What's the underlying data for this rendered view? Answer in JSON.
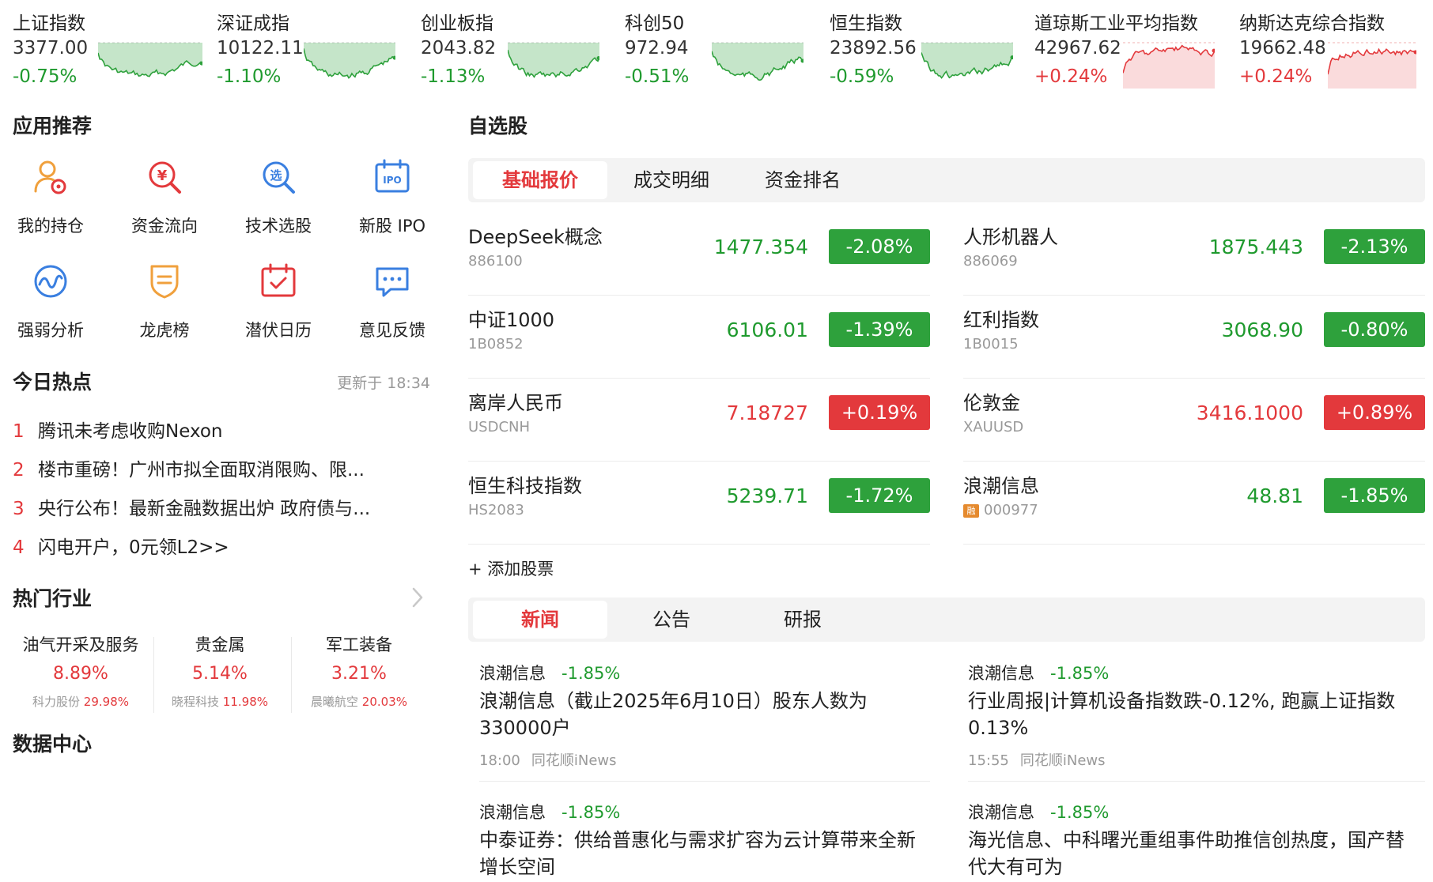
{
  "indices": [
    {
      "name": "上证指数",
      "value": "3377.00",
      "change": "-0.75%",
      "dir": "down"
    },
    {
      "name": "深证成指",
      "value": "10122.11",
      "change": "-1.10%",
      "dir": "down"
    },
    {
      "name": "创业板指",
      "value": "2043.82",
      "change": "-1.13%",
      "dir": "down"
    },
    {
      "name": "科创50",
      "value": "972.94",
      "change": "-0.51%",
      "dir": "down"
    },
    {
      "name": "恒生指数",
      "value": "23892.56",
      "change": "-0.59%",
      "dir": "down"
    },
    {
      "name": "道琼斯工业平均指数",
      "value": "42967.62",
      "change": "+0.24%",
      "dir": "up"
    },
    {
      "name": "纳斯达克综合指数",
      "value": "19662.48",
      "change": "+0.24%",
      "dir": "up"
    }
  ],
  "apps": {
    "title": "应用推荐",
    "items": [
      {
        "label": "我的持仓",
        "icon": "portfolio-icon"
      },
      {
        "label": "资金流向",
        "icon": "fund-flow-icon"
      },
      {
        "label": "技术选股",
        "icon": "stock-picker-icon"
      },
      {
        "label": "新股 IPO",
        "icon": "ipo-icon"
      },
      {
        "label": "强弱分析",
        "icon": "strength-analysis-icon"
      },
      {
        "label": "龙虎榜",
        "icon": "dragon-tiger-icon"
      },
      {
        "label": "潜伏日历",
        "icon": "calendar-icon"
      },
      {
        "label": "意见反馈",
        "icon": "feedback-icon"
      }
    ]
  },
  "hot": {
    "title": "今日热点",
    "updated": "更新于 18:34",
    "items": [
      {
        "no": "1",
        "text": "腾讯未考虑收购Nexon"
      },
      {
        "no": "2",
        "text": "楼市重磅！广州市拟全面取消限购、限..."
      },
      {
        "no": "3",
        "text": "央行公布！最新金融数据出炉 政府债与..."
      },
      {
        "no": "4",
        "text": "闪电开户，0元领L2>>"
      }
    ]
  },
  "industry": {
    "title": "热门行业",
    "items": [
      {
        "name": "油气开采及服务",
        "change": "8.89%",
        "lead": "科力股份",
        "lead_change": "29.98%"
      },
      {
        "name": "贵金属",
        "change": "5.14%",
        "lead": "晓程科技",
        "lead_change": "11.98%"
      },
      {
        "name": "军工装备",
        "change": "3.21%",
        "lead": "晨曦航空",
        "lead_change": "20.03%"
      }
    ]
  },
  "data_center": {
    "title": "数据中心"
  },
  "watchlist": {
    "title": "自选股",
    "tabs": [
      "基础报价",
      "成交明细",
      "资金排名"
    ],
    "stocks": [
      {
        "name": "DeepSeek概念",
        "code": "886100",
        "price": "1477.354",
        "change": "-2.08%",
        "dir": "down",
        "rong": ""
      },
      {
        "name": "人形机器人",
        "code": "886069",
        "price": "1875.443",
        "change": "-2.13%",
        "dir": "down",
        "rong": ""
      },
      {
        "name": "中证1000",
        "code": "1B0852",
        "price": "6106.01",
        "change": "-1.39%",
        "dir": "down",
        "rong": ""
      },
      {
        "name": "红利指数",
        "code": "1B0015",
        "price": "3068.90",
        "change": "-0.80%",
        "dir": "down",
        "rong": ""
      },
      {
        "name": "离岸人民币",
        "code": "USDCNH",
        "price": "7.18727",
        "change": "+0.19%",
        "dir": "up",
        "rong": ""
      },
      {
        "name": "伦敦金",
        "code": "XAUUSD",
        "price": "3416.1000",
        "change": "+0.89%",
        "dir": "up",
        "rong": ""
      },
      {
        "name": "恒生科技指数",
        "code": "HS2083",
        "price": "5239.71",
        "change": "-1.72%",
        "dir": "down",
        "rong": ""
      },
      {
        "name": "浪潮信息",
        "code": "000977",
        "price": "48.81",
        "change": "-1.85%",
        "dir": "down",
        "rong": "融"
      }
    ],
    "add_label": "+ 添加股票"
  },
  "news_tabs": [
    "新闻",
    "公告",
    "研报"
  ],
  "news": [
    {
      "stock": "浪潮信息",
      "change": "-1.85%",
      "title": "浪潮信息（截止2025年6月10日）股东人数为330000户",
      "time": "18:00",
      "source": "同花顺iNews"
    },
    {
      "stock": "浪潮信息",
      "change": "-1.85%",
      "title": "行业周报|计算机设备指数跌-0.12%, 跑赢上证指数0.13%",
      "time": "15:55",
      "source": "同花顺iNews"
    },
    {
      "stock": "浪潮信息",
      "change": "-1.85%",
      "title": "中泰证券：供给普惠化与需求扩容为云计算带来全新增长空间",
      "time": "",
      "source": ""
    },
    {
      "stock": "浪潮信息",
      "change": "-1.85%",
      "title": "海光信息、中科曙光重组事件助推信创热度，国产替代大有可为",
      "time": "",
      "source": ""
    }
  ],
  "colors": {
    "up": "#e3393c",
    "down": "#1f9a2e",
    "down_badge": "#2ea13c"
  }
}
